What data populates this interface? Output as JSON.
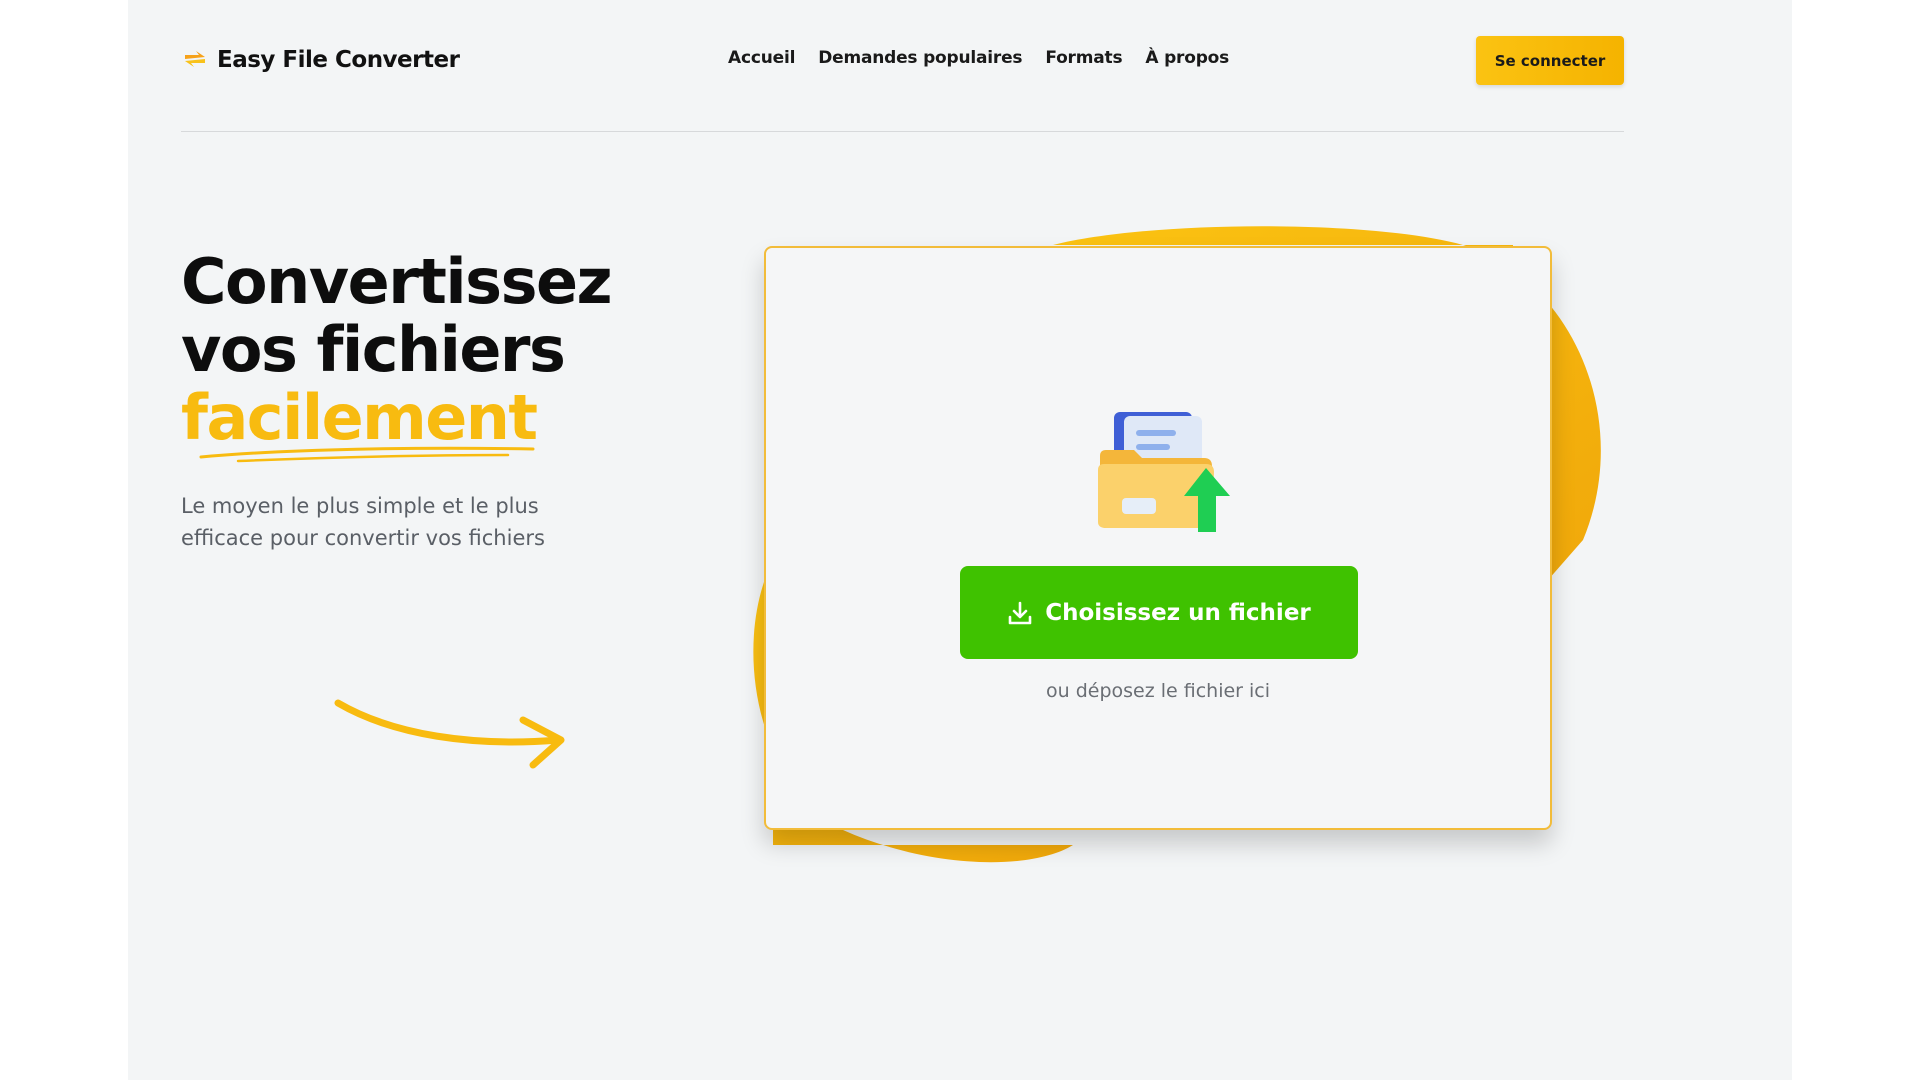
{
  "brand": {
    "name": "Easy File Converter",
    "accent_color": "#f8bb10",
    "logo_icon": "bolt-arrows-icon"
  },
  "nav": {
    "items": [
      {
        "label": "Accueil"
      },
      {
        "label": "Demandes populaires"
      },
      {
        "label": "Formats"
      },
      {
        "label": "À propos"
      }
    ],
    "login_label": "Se connecter"
  },
  "hero": {
    "title_line1": "Convertissez",
    "title_line2": "vos fichiers",
    "title_accent": "facilement",
    "subtitle": "Le moyen le plus simple et le plus efficace pour convertir vos fichiers"
  },
  "upload": {
    "button_label": "Choisissez un fichier",
    "button_icon": "download-icon",
    "button_color": "#3fc200",
    "drop_hint": "ou déposez le fichier ici",
    "illustration": "folder-upload-icon"
  }
}
